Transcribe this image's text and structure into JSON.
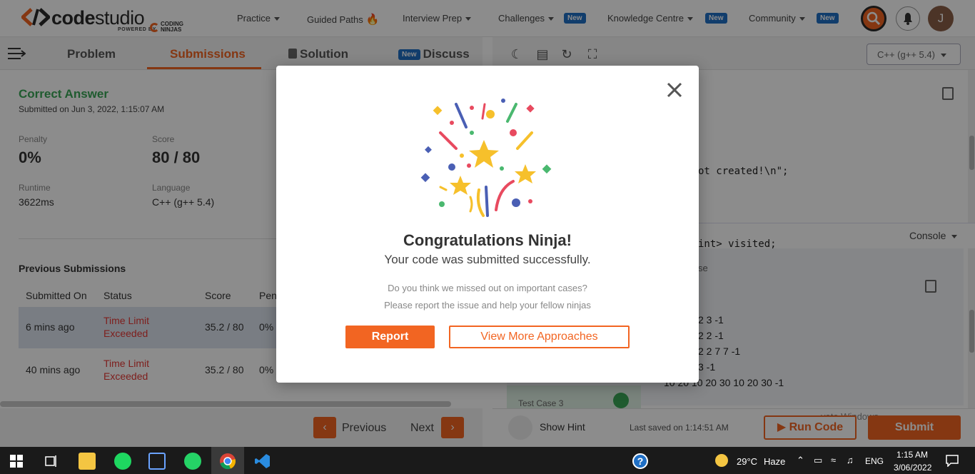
{
  "brand": {
    "name_bold": "code",
    "name_light": "studio",
    "powered_by": "POWERED BY",
    "partner_line1": "CODING",
    "partner_line2": "NINJAS",
    "accent_color": "#f26522"
  },
  "nav": {
    "items": [
      {
        "label": "Practice"
      },
      {
        "label": "Guided Paths"
      },
      {
        "label": "Interview Prep"
      },
      {
        "label": "Challenges"
      },
      {
        "label": "Knowledge Centre"
      },
      {
        "label": "Community"
      }
    ],
    "new_badge": "New",
    "avatar_initial": "J"
  },
  "left_tabs": {
    "problem": "Problem",
    "submissions": "Submissions",
    "solution": "Solution",
    "discuss": "Discuss",
    "discuss_badge": "New"
  },
  "result": {
    "status": "Correct Answer",
    "submitted_on": "Submitted on Jun 3, 2022, 1:15:07 AM",
    "penalty_label": "Penalty",
    "penalty_value": "0%",
    "score_label": "Score",
    "score_value": "80 / 80",
    "runtime_label": "Runtime",
    "runtime_value": "3622ms",
    "language_label": "Language",
    "language_value": "C++ (g++ 5.4)"
  },
  "previous": {
    "title": "Previous Submissions",
    "headers": [
      "Submitted On",
      "Status",
      "Score",
      "Pen"
    ],
    "rows": [
      {
        "when": "6 mins ago",
        "status_line1": "Time Limit",
        "status_line2": "Exceeded",
        "score": "35.2 / 80",
        "penalty": "0%"
      },
      {
        "when": "40 mins ago",
        "status_line1": "Time Limit",
        "status_line2": "Exceeded",
        "score": "35.2 / 80",
        "penalty": "0%"
      }
    ]
  },
  "pager": {
    "previous": "Previous",
    "next": "Next"
  },
  "editor": {
    "language": "C++ (g++ 5.4)",
    "code_fragments": [
      "ot created!\\n\";",
      "int> visited;"
    ],
    "console_label": "Console",
    "console_fragment": "se",
    "console_lines": [
      "2 3 -1",
      "2 2 -1",
      "2 2 7 7 -1",
      "3 -1",
      "10 20 10 20 30 10 20 30 -1"
    ],
    "testcase_label": "Test Case 3"
  },
  "footer": {
    "hint": "Show Hint",
    "last_saved": "Last saved on 1:14:51 AM",
    "run": "Run Code",
    "submit": "Submit",
    "watermark": "vate Windows."
  },
  "modal": {
    "title": "Congratulations Ninja!",
    "subtitle": "Your code was submitted successfully.",
    "question1": "Do you think we missed out on important cases?",
    "question2": "Please report the issue and help your fellow ninjas",
    "report": "Report",
    "approaches": "View More Approaches"
  },
  "taskbar": {
    "weather": "29°C",
    "weather_desc": "Haze",
    "lang": "ENG",
    "time": "1:15 AM",
    "date": "3/06/2022"
  }
}
